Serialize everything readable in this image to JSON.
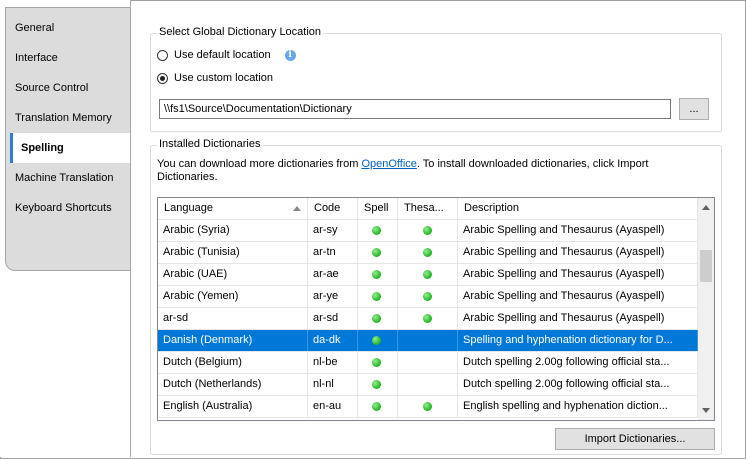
{
  "sidebar": {
    "items": [
      {
        "label": "General",
        "active": false
      },
      {
        "label": "Interface",
        "active": false
      },
      {
        "label": "Source Control",
        "active": false
      },
      {
        "label": "Translation Memory",
        "active": false
      },
      {
        "label": "Spelling",
        "active": true
      },
      {
        "label": "Machine Translation",
        "active": false
      },
      {
        "label": "Keyboard Shortcuts",
        "active": false
      }
    ]
  },
  "location": {
    "title": "Select Global Dictionary Location",
    "default_label": "Use default location",
    "custom_label": "Use custom location",
    "selected": "custom",
    "path": "\\\\fs1\\Source\\Documentation\\Dictionary",
    "browse_label": "..."
  },
  "installed": {
    "title": "Installed Dictionaries",
    "note_before": "You can download more dictionaries from ",
    "note_link": "OpenOffice",
    "note_after": ". To install downloaded dictionaries, click Import Dictionaries.",
    "columns": {
      "language": "Language",
      "code": "Code",
      "spell": "Spell",
      "thesaurus": "Thesa...",
      "description": "Description"
    },
    "rows": [
      {
        "language": "Arabic (Syria)",
        "code": "ar-sy",
        "spell": true,
        "thesaurus": true,
        "description": "Arabic Spelling and Thesaurus (Ayaspell)",
        "selected": false
      },
      {
        "language": "Arabic (Tunisia)",
        "code": "ar-tn",
        "spell": true,
        "thesaurus": true,
        "description": "Arabic Spelling and Thesaurus (Ayaspell)",
        "selected": false
      },
      {
        "language": "Arabic (UAE)",
        "code": "ar-ae",
        "spell": true,
        "thesaurus": true,
        "description": "Arabic Spelling and Thesaurus (Ayaspell)",
        "selected": false
      },
      {
        "language": "Arabic (Yemen)",
        "code": "ar-ye",
        "spell": true,
        "thesaurus": true,
        "description": "Arabic Spelling and Thesaurus (Ayaspell)",
        "selected": false
      },
      {
        "language": "ar-sd",
        "code": "ar-sd",
        "spell": true,
        "thesaurus": true,
        "description": "Arabic Spelling and Thesaurus (Ayaspell)",
        "selected": false
      },
      {
        "language": "Danish (Denmark)",
        "code": "da-dk",
        "spell": true,
        "thesaurus": false,
        "description": "Spelling and hyphenation dictionary for D...",
        "selected": true
      },
      {
        "language": "Dutch (Belgium)",
        "code": "nl-be",
        "spell": true,
        "thesaurus": false,
        "description": "Dutch spelling 2.00g following official sta...",
        "selected": false
      },
      {
        "language": "Dutch (Netherlands)",
        "code": "nl-nl",
        "spell": true,
        "thesaurus": false,
        "description": "Dutch spelling 2.00g following official sta...",
        "selected": false
      },
      {
        "language": "English (Australia)",
        "code": "en-au",
        "spell": true,
        "thesaurus": true,
        "description": "English spelling and hyphenation diction...",
        "selected": false
      }
    ],
    "import_label": "Import Dictionaries..."
  },
  "colors": {
    "selection": "#0078d7",
    "link": "#0563c1",
    "status_dot": "#22b022"
  }
}
